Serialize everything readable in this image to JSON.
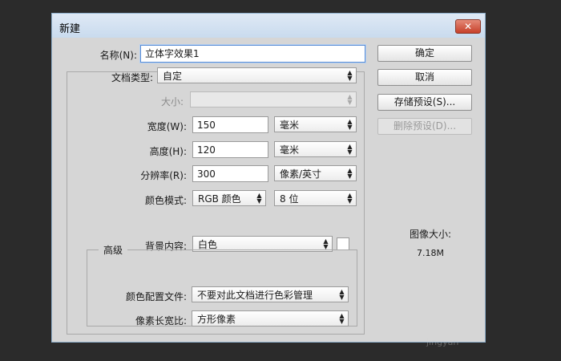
{
  "dialog": {
    "title": "新建",
    "close_label": "✕"
  },
  "form": {
    "name_label": "名称(N):",
    "name_value": "立体字效果1",
    "doc_type_label": "文档类型:",
    "doc_type_value": "自定",
    "size_label": "大小:",
    "size_value": "",
    "width_label": "宽度(W):",
    "width_value": "150",
    "width_unit": "毫米",
    "height_label": "高度(H):",
    "height_value": "120",
    "height_unit": "毫米",
    "resolution_label": "分辨率(R):",
    "resolution_value": "300",
    "resolution_unit": "像素/英寸",
    "color_mode_label": "颜色模式:",
    "color_mode_value": "RGB 颜色",
    "bit_depth_value": "8 位",
    "background_label": "背景内容:",
    "background_value": "白色",
    "background_swatch_color": "#ffffff",
    "advanced_title": "高级",
    "color_profile_label": "颜色配置文件:",
    "color_profile_value": "不要对此文档进行色彩管理",
    "pixel_aspect_label": "像素长宽比:",
    "pixel_aspect_value": "方形像素"
  },
  "buttons": {
    "ok": "确定",
    "cancel": "取消",
    "save_preset": "存储预设(S)...",
    "delete_preset": "删除预设(D)..."
  },
  "info": {
    "image_size_label": "图像大小:",
    "image_size_value": "7.18M"
  },
  "watermark": "jingyan",
  "colors": {
    "dialog_bg": "#d6d6d6",
    "titlebar": "#c9dbee",
    "close_button": "#c6402a",
    "focus_border": "#5b8ed6"
  }
}
